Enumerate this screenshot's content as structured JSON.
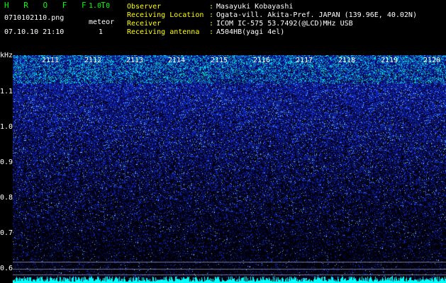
{
  "header": {
    "app_name": "H R O F F T",
    "app_version": "1.0.0",
    "filename": "0710102110.png",
    "meteor_label": "meteor",
    "meteor_count": "1",
    "datetime": "07.10.10 21:10"
  },
  "info": [
    {
      "label": "Observer",
      "value": "Masayuki Kobayashi"
    },
    {
      "label": "Receiving Location",
      "value": "Ogata-vill. Akita-Pref. JAPAN (139.96E, 40.02N)"
    },
    {
      "label": "Receiver",
      "value": "ICOM IC-575 53.7492(@LCD)MHz USB"
    },
    {
      "label": "Receiving antenna",
      "value": "A504HB(yagi 4el)"
    }
  ],
  "yaxis": {
    "unit": "kHz",
    "ticks": [
      "1.1",
      "1.0",
      "0.9",
      "0.8",
      "0.7",
      "0.6"
    ]
  },
  "time_labels": [
    "2111",
    "2112",
    "2113",
    "2114",
    "2115",
    "2116",
    "2117",
    "2118",
    "2119",
    "2120"
  ],
  "colors": {
    "background": "#000000",
    "header_green": "#00ff00",
    "header_yellow": "#ffff00",
    "signal_cyan": "#00ffff",
    "signal_blue": "#2040ff"
  }
}
